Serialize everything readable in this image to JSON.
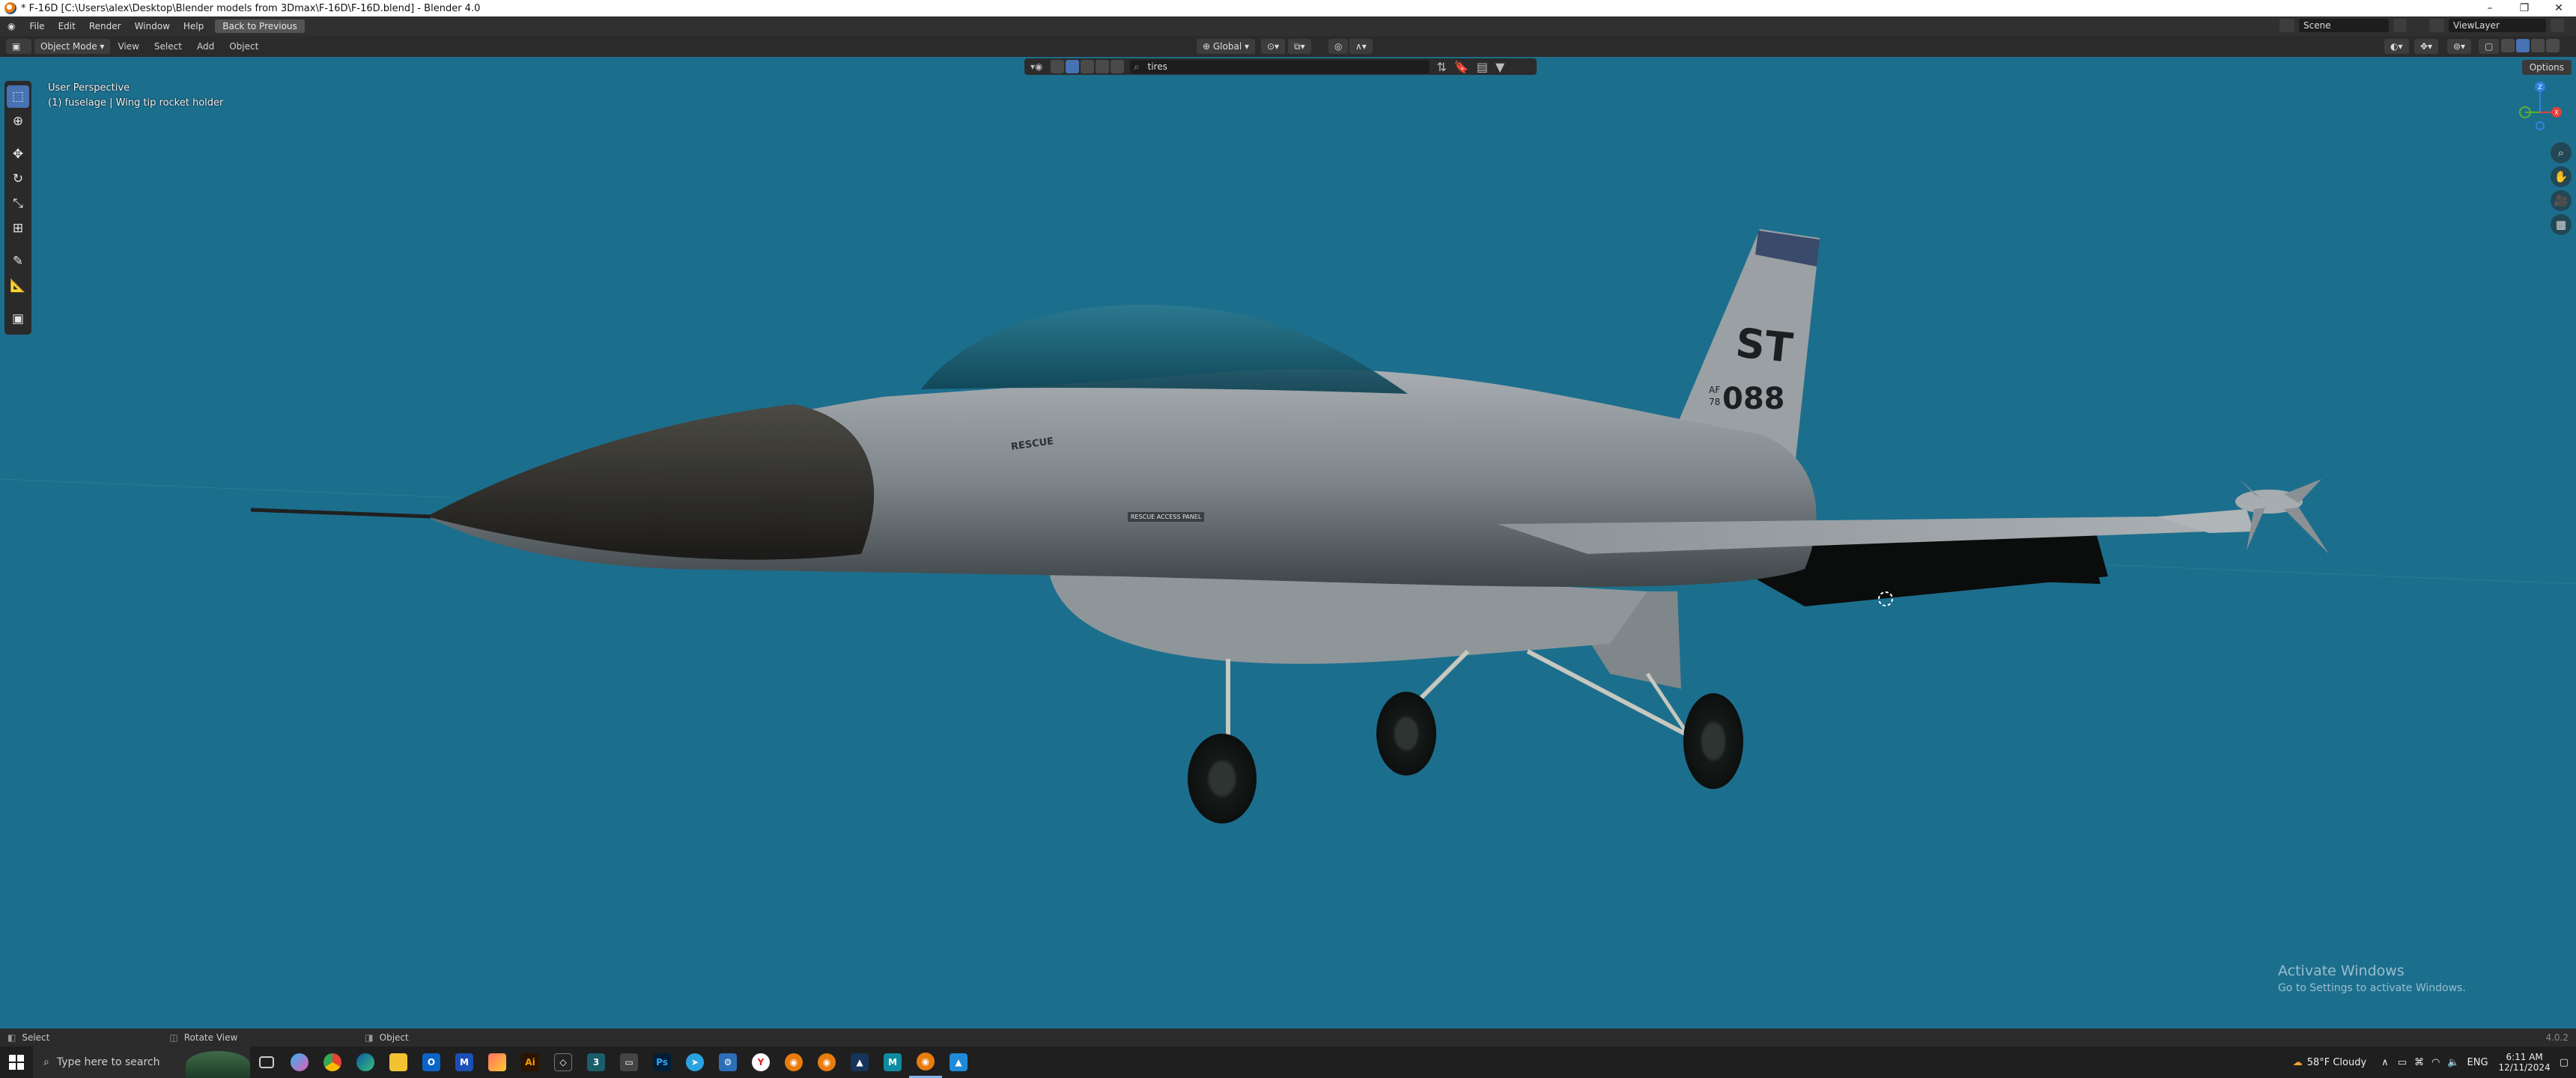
{
  "window": {
    "title": "* F-16D [C:\\Users\\alex\\Desktop\\Blender models from 3Dmax\\F-16D\\F-16D.blend] - Blender 4.0",
    "minimize": "–",
    "maximize": "❐",
    "close": "✕"
  },
  "menubar": {
    "items": [
      "File",
      "Edit",
      "Render",
      "Window",
      "Help"
    ],
    "back_button": "Back to Previous",
    "scene": "Scene",
    "view_layer": "ViewLayer"
  },
  "header": {
    "mode": "Object Mode",
    "menus": [
      "View",
      "Select",
      "Add",
      "Object"
    ],
    "orientation": "Global",
    "options": "Options"
  },
  "outliner_filter": {
    "search_value": "tires"
  },
  "viewport": {
    "perspective": "User Perspective",
    "selection": "(1) fuselage | Wing tip rocket holder",
    "background_color": "#1c6e8d"
  },
  "aircraft": {
    "nose_label": "RESCUE",
    "tail_code": "ST",
    "tail_number": "088",
    "tail_prefix_top": "AF",
    "tail_prefix_bottom": "78",
    "warning_text": "RESCUE ACCESS PANEL"
  },
  "gizmo": {
    "x": "X",
    "y": "Y",
    "z": "Z"
  },
  "statusbar": {
    "left": "Select",
    "middle": "Rotate View",
    "right": "Object",
    "version": "4.0.2"
  },
  "watermark": {
    "line1": "Activate Windows",
    "line2": "Go to Settings to activate Windows."
  },
  "taskbar": {
    "search_placeholder": "Type here to search",
    "weather": "58°F  Cloudy",
    "lang": "ENG",
    "time": "6:11 AM",
    "date": "12/11/2024"
  }
}
